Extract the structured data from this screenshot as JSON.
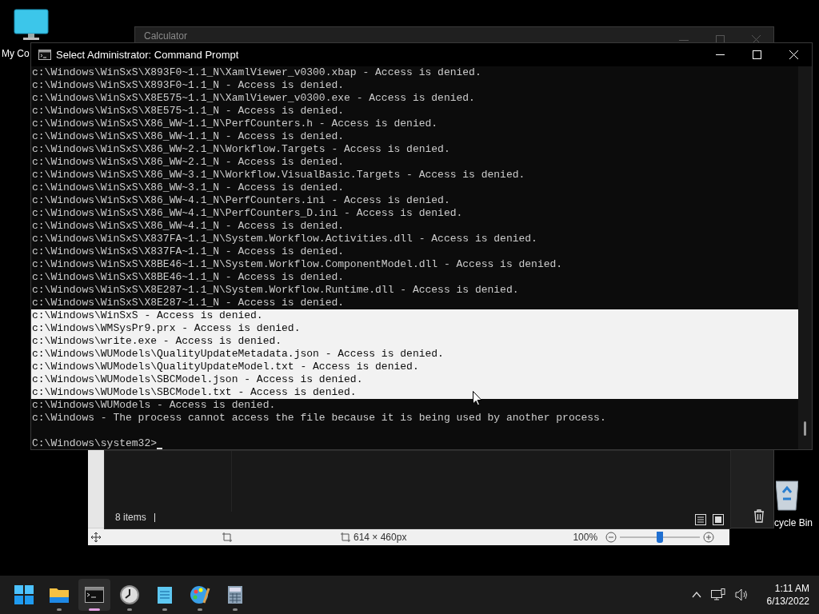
{
  "desktop_icons": [
    {
      "kind": "computer",
      "label": "My Co"
    },
    {
      "kind": "recycle_bin",
      "label": "cycle Bin"
    }
  ],
  "calculator": {
    "title": "Calculator"
  },
  "paint": {
    "image_size": "614 × 460px",
    "zoom": "100%",
    "zoom_slider": {
      "level": 0.5
    }
  },
  "explorer": {
    "status": "8 items"
  },
  "console": {
    "title": "Select Administrator: Command Prompt",
    "lines": [
      {
        "text": "c:\\Windows\\WinSxS\\X893F0~1.1_N\\XamlViewer_v0300.xbap - Access is denied.",
        "selected": false
      },
      {
        "text": "c:\\Windows\\WinSxS\\X893F0~1.1_N - Access is denied.",
        "selected": false
      },
      {
        "text": "c:\\Windows\\WinSxS\\X8E575~1.1_N\\XamlViewer_v0300.exe - Access is denied.",
        "selected": false
      },
      {
        "text": "c:\\Windows\\WinSxS\\X8E575~1.1_N - Access is denied.",
        "selected": false
      },
      {
        "text": "c:\\Windows\\WinSxS\\X86_WW~1.1_N\\PerfCounters.h - Access is denied.",
        "selected": false
      },
      {
        "text": "c:\\Windows\\WinSxS\\X86_WW~1.1_N - Access is denied.",
        "selected": false
      },
      {
        "text": "c:\\Windows\\WinSxS\\X86_WW~2.1_N\\Workflow.Targets - Access is denied.",
        "selected": false
      },
      {
        "text": "c:\\Windows\\WinSxS\\X86_WW~2.1_N - Access is denied.",
        "selected": false
      },
      {
        "text": "c:\\Windows\\WinSxS\\X86_WW~3.1_N\\Workflow.VisualBasic.Targets - Access is denied.",
        "selected": false
      },
      {
        "text": "c:\\Windows\\WinSxS\\X86_WW~3.1_N - Access is denied.",
        "selected": false
      },
      {
        "text": "c:\\Windows\\WinSxS\\X86_WW~4.1_N\\PerfCounters.ini - Access is denied.",
        "selected": false
      },
      {
        "text": "c:\\Windows\\WinSxS\\X86_WW~4.1_N\\PerfCounters_D.ini - Access is denied.",
        "selected": false
      },
      {
        "text": "c:\\Windows\\WinSxS\\X86_WW~4.1_N - Access is denied.",
        "selected": false
      },
      {
        "text": "c:\\Windows\\WinSxS\\X837FA~1.1_N\\System.Workflow.Activities.dll - Access is denied.",
        "selected": false
      },
      {
        "text": "c:\\Windows\\WinSxS\\X837FA~1.1_N - Access is denied.",
        "selected": false
      },
      {
        "text": "c:\\Windows\\WinSxS\\X8BE46~1.1_N\\System.Workflow.ComponentModel.dll - Access is denied.",
        "selected": false
      },
      {
        "text": "c:\\Windows\\WinSxS\\X8BE46~1.1_N - Access is denied.",
        "selected": false
      },
      {
        "text": "c:\\Windows\\WinSxS\\X8E287~1.1_N\\System.Workflow.Runtime.dll - Access is denied.",
        "selected": false
      },
      {
        "text": "c:\\Windows\\WinSxS\\X8E287~1.1_N - Access is denied.",
        "selected": false
      },
      {
        "text": "c:\\Windows\\WinSxS - Access is denied.",
        "selected": true
      },
      {
        "text": "c:\\Windows\\WMSysPr9.prx - Access is denied.",
        "selected": true
      },
      {
        "text": "c:\\Windows\\write.exe - Access is denied.",
        "selected": true
      },
      {
        "text": "c:\\Windows\\WUModels\\QualityUpdateMetadata.json - Access is denied.",
        "selected": true
      },
      {
        "text": "c:\\Windows\\WUModels\\QualityUpdateModel.txt - Access is denied.",
        "selected": true
      },
      {
        "text": "c:\\Windows\\WUModels\\SBCModel.json - Access is denied.",
        "selected": true
      },
      {
        "text": "c:\\Windows\\WUModels\\SBCModel.txt - Access is denied.",
        "selected": true
      },
      {
        "text": "c:\\Windows\\WUModels - Access is denied.",
        "selected": false
      },
      {
        "text": "c:\\Windows - The process cannot access the file because it is being used by another process.",
        "selected": false
      }
    ],
    "prompt": "C:\\Windows\\system32>"
  },
  "taskbar": {
    "apps": [
      {
        "kind": "start",
        "selected": false
      },
      {
        "kind": "folder",
        "selected": false
      },
      {
        "kind": "terminal",
        "selected": true
      },
      {
        "kind": "clock",
        "selected": false
      },
      {
        "kind": "notepad",
        "selected": false
      },
      {
        "kind": "paint",
        "selected": false
      },
      {
        "kind": "calculator",
        "selected": false
      }
    ],
    "time": "1:11 AM",
    "date": "6/13/2022"
  }
}
